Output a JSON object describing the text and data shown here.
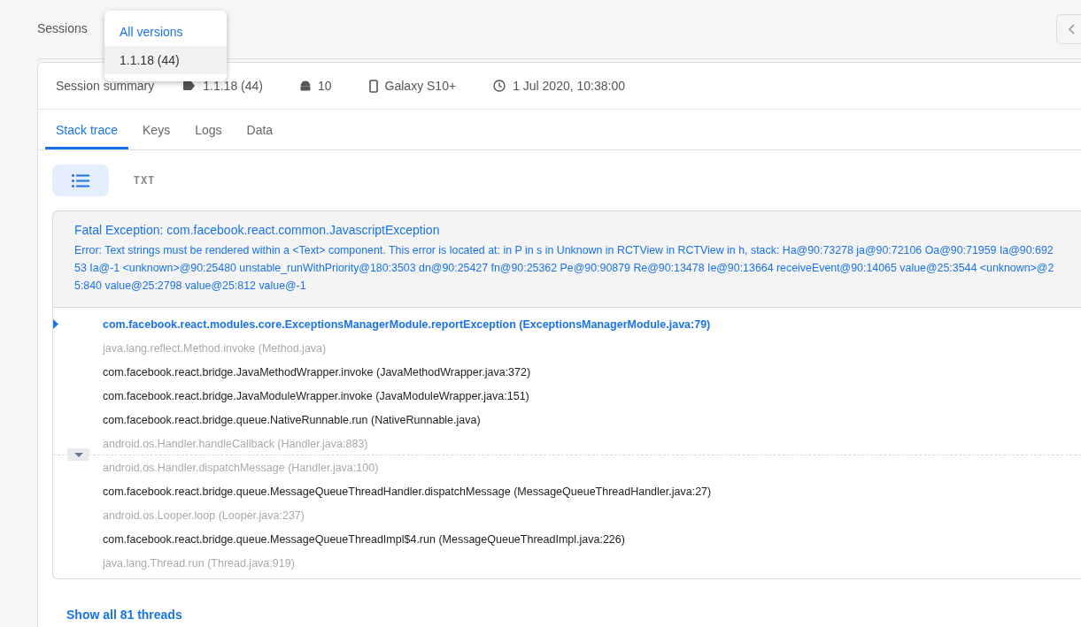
{
  "header": {
    "title": "Sessions"
  },
  "version_menu": {
    "items": [
      {
        "label": "All versions",
        "selected": true,
        "hovered": false
      },
      {
        "label": "1.1.18 (44)",
        "selected": false,
        "hovered": true
      }
    ]
  },
  "summary": {
    "title": "Session summary",
    "version": "1.1.18 (44)",
    "os": "10",
    "device": "Galaxy S10+",
    "time": "1 Jul 2020, 10:38:00"
  },
  "tabs": [
    {
      "label": "Stack trace",
      "selected": true
    },
    {
      "label": "Keys",
      "selected": false
    },
    {
      "label": "Logs",
      "selected": false
    },
    {
      "label": "Data",
      "selected": false
    }
  ],
  "view_toggle": [
    {
      "kind": "list",
      "selected": true
    },
    {
      "kind": "text",
      "label": "TXT",
      "selected": false
    }
  ],
  "exception": {
    "title": "Fatal Exception: com.facebook.react.common.JavascriptException",
    "message": "Error: Text strings must be rendered within a <Text> component. This error is located at: in P in s in Unknown in RCTView in RCTView in h, stack: Ha@90:73278 ja@90:72106 Oa@90:71959 Ia@90:69253 Ia@-1 <unknown>@90:25480 unstable_runWithPriority@180:3503 dn@90:25427 fn@90:25362 Pe@90:90879 Re@90:13478 Ie@90:13664 receiveEvent@90:14065 value@25:3544 <unknown>@25:840 value@25:2798 value@25:812 value@-1"
  },
  "frames": [
    {
      "text": "com.facebook.react.modules.core.ExceptionsManagerModule.reportException (ExceptionsManagerModule.java:79)",
      "kind": "blamed"
    },
    {
      "text": "java.lang.reflect.Method.invoke (Method.java)",
      "kind": "system"
    },
    {
      "text": "com.facebook.react.bridge.JavaMethodWrapper.invoke (JavaMethodWrapper.java:372)",
      "kind": "app"
    },
    {
      "text": "com.facebook.react.bridge.JavaModuleWrapper.invoke (JavaModuleWrapper.java:151)",
      "kind": "app"
    },
    {
      "text": "com.facebook.react.bridge.queue.NativeRunnable.run (NativeRunnable.java)",
      "kind": "app"
    },
    {
      "text": "android.os.Handler.handleCallback (Handler.java:883)",
      "kind": "system"
    },
    {
      "text": "android.os.Handler.dispatchMessage (Handler.java:100)",
      "kind": "system",
      "collapse_above": true
    },
    {
      "text": "com.facebook.react.bridge.queue.MessageQueueThreadHandler.dispatchMessage (MessageQueueThreadHandler.java:27)",
      "kind": "app"
    },
    {
      "text": "android.os.Looper.loop (Looper.java:237)",
      "kind": "system"
    },
    {
      "text": "com.facebook.react.bridge.queue.MessageQueueThreadImpl$4.run (MessageQueueThreadImpl.java:226)",
      "kind": "app"
    },
    {
      "text": "java.lang.Thread.run (Thread.java:919)",
      "kind": "system"
    }
  ],
  "threads_link": "Show all 81 threads"
}
